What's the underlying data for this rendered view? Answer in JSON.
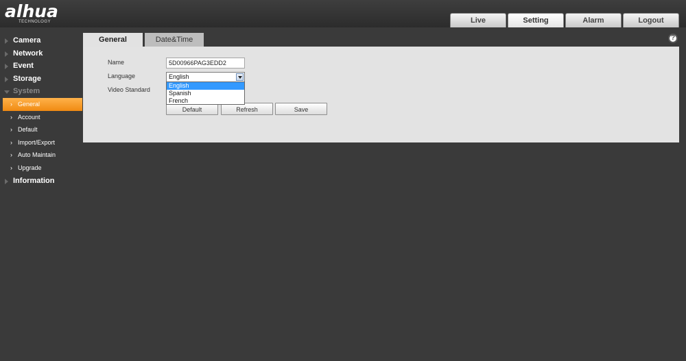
{
  "header": {
    "logo_text": "alhua",
    "logo_subtext": "TECHNOLOGY",
    "tabs": [
      {
        "label": "Live"
      },
      {
        "label": "Setting"
      },
      {
        "label": "Alarm"
      },
      {
        "label": "Logout"
      }
    ],
    "active_tab": "Setting"
  },
  "sidebar": {
    "items": [
      {
        "label": "Camera"
      },
      {
        "label": "Network"
      },
      {
        "label": "Event"
      },
      {
        "label": "Storage"
      },
      {
        "label": "System"
      },
      {
        "label": "Information"
      }
    ],
    "system_subitems": [
      {
        "label": "General"
      },
      {
        "label": "Account"
      },
      {
        "label": "Default"
      },
      {
        "label": "Import/Export"
      },
      {
        "label": "Auto Maintain"
      },
      {
        "label": "Upgrade"
      }
    ],
    "active_subitem": "General"
  },
  "content": {
    "tabs": [
      {
        "label": "General"
      },
      {
        "label": "Date&Time"
      }
    ],
    "help_icon": "?",
    "form": {
      "name_label": "Name",
      "name_value": "5D00966PAG3EDD2",
      "language_label": "Language",
      "language_value": "English",
      "language_options": [
        "English",
        "Spanish",
        "French"
      ],
      "video_standard_label": "Video Standard"
    },
    "buttons": {
      "default_label": "Default",
      "refresh_label": "Refresh",
      "save_label": "Save"
    }
  },
  "colors": {
    "background": "#3a3a3a",
    "active_nav": "#f08a12",
    "selected_option": "#3399ff",
    "panel": "#e3e3e3"
  }
}
